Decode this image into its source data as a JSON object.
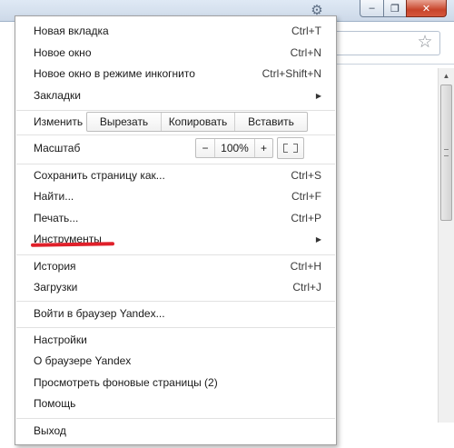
{
  "window": {
    "minimize_glyph": "–",
    "maximize_glyph": "❐",
    "close_glyph": "✕",
    "gear_glyph": "⚙",
    "star_glyph": "☆"
  },
  "menu": {
    "items": {
      "new_tab": {
        "label": "Новая вкладка",
        "shortcut": "Ctrl+T"
      },
      "new_window": {
        "label": "Новое окно",
        "shortcut": "Ctrl+N"
      },
      "incognito": {
        "label": "Новое окно в режиме инкогнито",
        "shortcut": "Ctrl+Shift+N"
      },
      "bookmarks": {
        "label": "Закладки",
        "arrow": "▶"
      },
      "save_page": {
        "label": "Сохранить страницу как...",
        "shortcut": "Ctrl+S"
      },
      "find": {
        "label": "Найти...",
        "shortcut": "Ctrl+F"
      },
      "print": {
        "label": "Печать...",
        "shortcut": "Ctrl+P"
      },
      "tools": {
        "label": "Инструменты",
        "arrow": "▶"
      },
      "history": {
        "label": "История",
        "shortcut": "Ctrl+H"
      },
      "downloads": {
        "label": "Загрузки",
        "shortcut": "Ctrl+J"
      },
      "sign_in": {
        "label": "Войти в браузер Yandex..."
      },
      "settings": {
        "label": "Настройки"
      },
      "about": {
        "label": "О браузере Yandex"
      },
      "background_pages": {
        "label": "Просмотреть фоновые страницы (2)"
      },
      "help": {
        "label": "Помощь"
      },
      "exit": {
        "label": "Выход"
      }
    },
    "edit": {
      "label": "Изменить",
      "cut": "Вырезать",
      "copy": "Копировать",
      "paste": "Вставить"
    },
    "zoom": {
      "label": "Масштаб",
      "minus": "−",
      "value": "100%",
      "plus": "+"
    },
    "highlight_color": "#e0202a"
  }
}
